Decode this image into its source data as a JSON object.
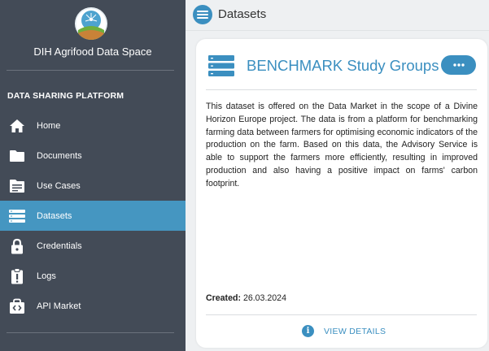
{
  "sidebar": {
    "org_name": "DIH Agrifood Data Space",
    "section_title": "DATA SHARING PLATFORM",
    "items": [
      {
        "label": "Home",
        "icon": "home-icon",
        "active": false
      },
      {
        "label": "Documents",
        "icon": "folder-icon",
        "active": false
      },
      {
        "label": "Use Cases",
        "icon": "file-text-icon",
        "active": false
      },
      {
        "label": "Datasets",
        "icon": "database-list-icon",
        "active": true
      },
      {
        "label": "Credentials",
        "icon": "lock-icon",
        "active": false
      },
      {
        "label": "Logs",
        "icon": "alert-clipboard-icon",
        "active": false
      },
      {
        "label": "API Market",
        "icon": "code-bag-icon",
        "active": false
      }
    ]
  },
  "header": {
    "title": "Datasets"
  },
  "card": {
    "title": "BENCHMARK Study Groups",
    "description": "This dataset is offered on the Data Market in the scope of a Divine Horizon Europe project. The data is from a platform for benchmarking farming data between farmers for optimising economic indicators of the production on the farm. Based on this data, the Advisory Service is able to support the farmers more efficiently, resulting in improved production and also having a positive impact on farms' carbon footprint.",
    "created_label": "Created:",
    "created_value": "26.03.2024",
    "details_label": "VIEW DETAILS"
  },
  "colors": {
    "sidebar_bg": "#434b57",
    "accent": "#3b8fc0",
    "active_item": "#4596c1"
  }
}
